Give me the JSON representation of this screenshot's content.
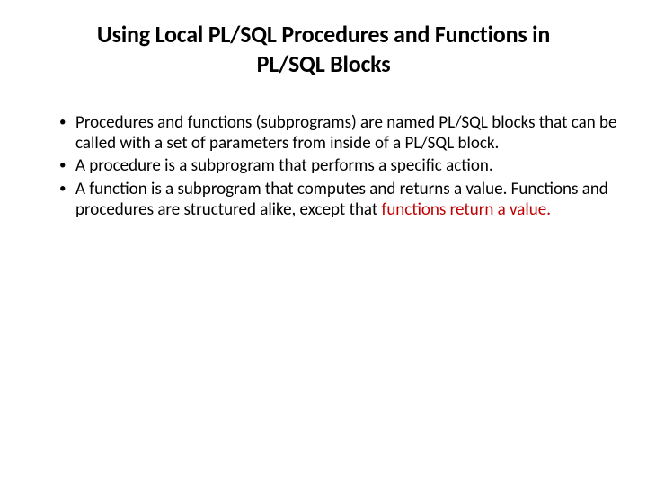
{
  "title_line1": "Using Local PL/SQL Procedures and Functions in",
  "title_line2": "PL/SQL Blocks",
  "bullets": [
    {
      "text_a": "Procedures and functions (subprograms) are named PL/SQL blocks that can be called with a set of parameters from inside of a PL/SQL block."
    },
    {
      "text_a": "A procedure is a subprogram that performs a specific action."
    },
    {
      "text_a": "A function is a subprogram that computes and returns a value. Functions and procedures are structured alike, except that ",
      "text_emph": "functions return a value."
    }
  ],
  "colors": {
    "emphasis": "#c00000"
  }
}
